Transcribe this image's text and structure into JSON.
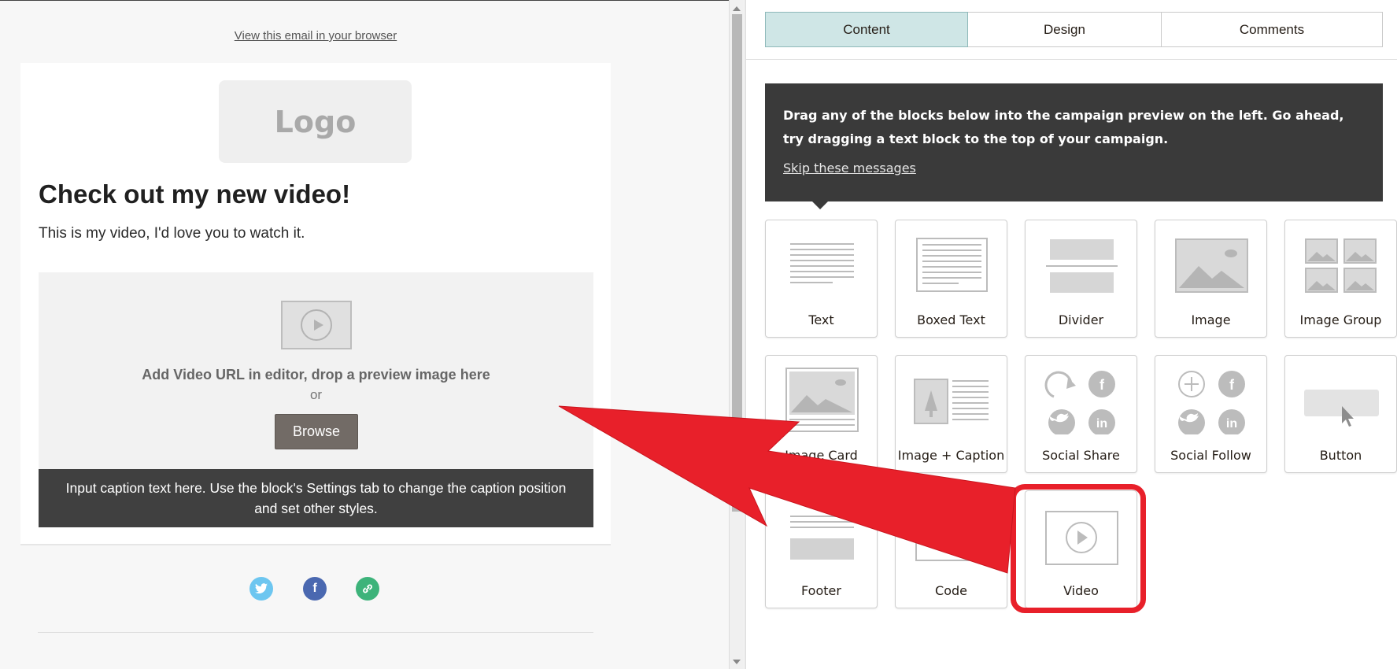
{
  "preview": {
    "view_in_browser": "View this email in your browser",
    "logo_text": "Logo",
    "heading": "Check out my new video!",
    "body": "This is my video, I'd love you to watch it.",
    "video_instruction": "Add Video URL in editor, drop a preview image here",
    "video_or": "or",
    "browse_label": "Browse",
    "caption": "Input caption text here. Use the block's Settings tab to change the caption position and set other styles.",
    "social_icons": [
      "twitter-icon",
      "facebook-icon",
      "link-icon"
    ],
    "social_colors": {
      "twitter": "#6dc6f0",
      "facebook": "#4a68b0",
      "link": "#3db37a"
    }
  },
  "panel": {
    "tabs": [
      {
        "label": "Content",
        "active": true
      },
      {
        "label": "Design",
        "active": false
      },
      {
        "label": "Comments",
        "active": false
      }
    ],
    "tip": {
      "text": "Drag any of the blocks below into the campaign preview on the left. Go ahead, try dragging a text block to the top of your campaign.",
      "skip_label": "Skip these messages"
    },
    "blocks": [
      {
        "label": "Text",
        "icon": "text-block-icon"
      },
      {
        "label": "Boxed Text",
        "icon": "boxed-text-block-icon"
      },
      {
        "label": "Divider",
        "icon": "divider-block-icon"
      },
      {
        "label": "Image",
        "icon": "image-block-icon"
      },
      {
        "label": "Image Group",
        "icon": "image-group-block-icon"
      },
      {
        "label": "Image Card",
        "icon": "image-card-block-icon"
      },
      {
        "label": "Image + Caption",
        "icon": "image-caption-block-icon"
      },
      {
        "label": "Social Share",
        "icon": "social-share-block-icon"
      },
      {
        "label": "Social Follow",
        "icon": "social-follow-block-icon"
      },
      {
        "label": "Button",
        "icon": "button-block-icon"
      },
      {
        "label": "Footer",
        "icon": "footer-block-icon"
      },
      {
        "label": "Code",
        "icon": "code-block-icon"
      },
      {
        "label": "Video",
        "icon": "video-block-icon"
      }
    ]
  },
  "annotation": {
    "highlight_color": "#e8202a",
    "arrow_color": "#e8202a"
  }
}
